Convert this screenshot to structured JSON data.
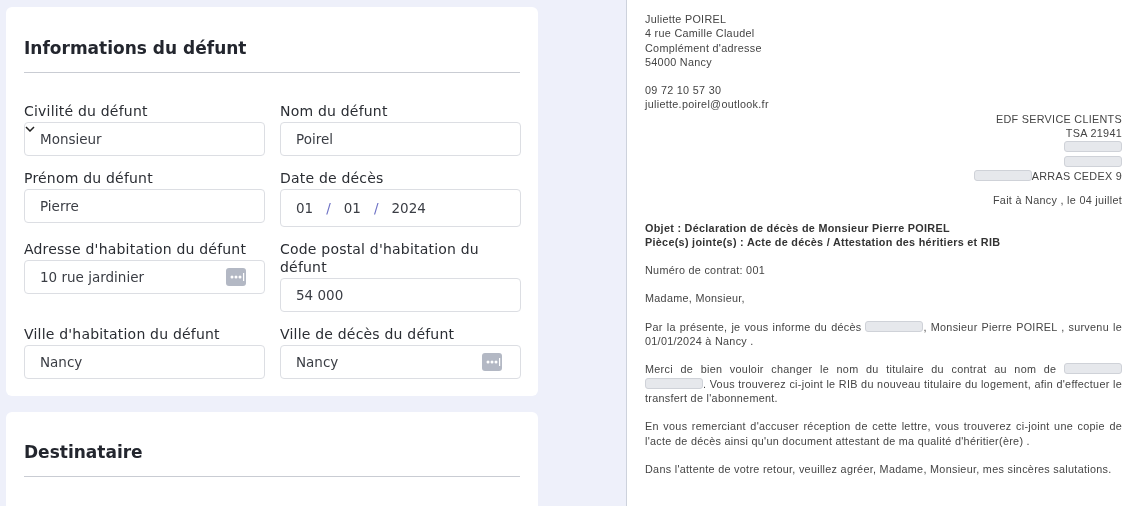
{
  "deceased_card": {
    "title": "Informations du défunt",
    "fields": [
      {
        "label": "Civilité du défunt",
        "value": "Monsieur",
        "kind": "select"
      },
      {
        "label": "Nom du défunt",
        "value": "Poirel",
        "kind": "text"
      },
      {
        "label": "Prénom du défunt",
        "value": "Pierre",
        "kind": "text"
      },
      {
        "label": "Date de décès",
        "kind": "date",
        "day": "01",
        "month": "01",
        "year": "2024",
        "separators": [
          "/",
          "/"
        ]
      },
      {
        "label": "Adresse d'habitation du défunt",
        "value": "10 rue jardinier",
        "kind": "lookup"
      },
      {
        "label": "Code postal d'habitation du défunt",
        "value": "54 000",
        "kind": "text"
      },
      {
        "label": "Ville d'habitation du défunt",
        "value": "Nancy",
        "kind": "text"
      },
      {
        "label": "Ville de décès du défunt",
        "value": "Nancy",
        "kind": "lookup"
      }
    ]
  },
  "recipient_card": {
    "title": "Destinataire"
  },
  "letter": {
    "sender": [
      "Juliette POIREL",
      "4 rue Camille Claudel",
      "Complément d'adresse",
      "54000 Nancy"
    ],
    "contact": [
      "09 72 10 57 30",
      "juliette.poirel@outlook.fr"
    ],
    "recipient": [
      [
        {
          "kind": "text",
          "text": "EDF SERVICE CLIENTS"
        }
      ],
      [
        {
          "kind": "text",
          "text": "TSA 21941"
        }
      ],
      [
        {
          "kind": "redacted"
        }
      ],
      [
        {
          "kind": "redacted"
        }
      ],
      [
        {
          "kind": "redacted"
        },
        {
          "kind": "text",
          "text": "ARRAS CEDEX 9"
        }
      ]
    ],
    "place_date": "Fait à Nancy , le 04 juillet",
    "subject": "Objet : Déclaration de décès de Monsieur Pierre POIREL",
    "attachments": "Pièce(s) jointe(s) : Acte de décès / Attestation des héritiers et RIB",
    "contract": "Numéro de contrat: 001",
    "salutation": "Madame, Monsieur,",
    "paragraphs": [
      [
        {
          "kind": "text",
          "text": "Par la présente, je vous informe du décès"
        },
        {
          "kind": "redacted"
        },
        {
          "kind": "text",
          "text": ", Monsieur Pierre POIREL , survenu le 01/01/2024 à Nancy ."
        }
      ],
      [
        {
          "kind": "text",
          "text": "Merci de bien vouloir changer le nom du titulaire du contrat au nom de"
        },
        {
          "kind": "redacted"
        },
        {
          "kind": "redacted"
        },
        {
          "kind": "text",
          "text": ". Vous trouverez ci-joint le RIB du nouveau titulaire du logement, afin d'effectuer le transfert de l'abonnement."
        }
      ],
      [
        {
          "kind": "text",
          "text": "En vous remerciant d'accuser réception de cette lettre, vous trouverez ci-joint une copie de l'acte de décès ainsi qu'un document attestant de ma qualité d'héritier(ère) ."
        }
      ],
      [
        {
          "kind": "text",
          "text": "Dans l'attente de votre retour, veuillez agréer, Madame, Monsieur, mes sincères salutations."
        }
      ]
    ]
  }
}
